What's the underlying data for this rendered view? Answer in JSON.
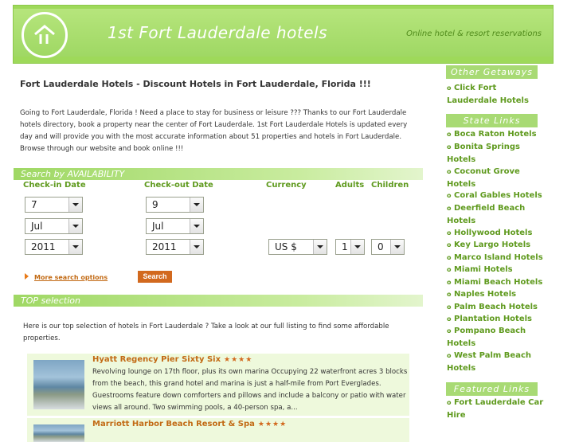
{
  "header": {
    "site_title": "1st Fort Lauderdale hotels",
    "tagline": "Online hotel & resort reservations",
    "logo_icon": "house-logo-icon"
  },
  "main": {
    "heading": "Fort Lauderdale Hotels - Discount Hotels in Fort Lauderdale, Florida !!!",
    "intro": "Going to Fort Lauderdale, Florida ! Need a place to stay for business or leisure ??? Thanks to our Fort Lauderdale hotels directory, book a property near the center of Fort Lauderdale. 1st Fort Lauderdale Hotels is updated every day and will provide you with the most accurate information about 51 properties and hotels in Fort Lauderdale. Browse through our website and book online !!!"
  },
  "search": {
    "title": "Search by AVAILABILITY",
    "labels": {
      "checkin": "Check-in Date",
      "checkout": "Check-out Date",
      "currency": "Currency",
      "adults": "Adults",
      "children": "Children"
    },
    "checkin": {
      "day": "7",
      "month": "Jul",
      "year": "2011"
    },
    "checkout": {
      "day": "9",
      "month": "Jul",
      "year": "2011"
    },
    "currency": "US $",
    "adults": "1",
    "children": "0",
    "more_options": "More search options",
    "button": "Search"
  },
  "top": {
    "title": "TOP selection",
    "intro": "Here is our top selection of hotels in Fort Lauderdale ? Take a look at our full listing to find some affordable properties.",
    "hotels": [
      {
        "name": "Hyatt Regency Pier Sixty Six",
        "stars": "★★★★",
        "description": "Revolving lounge on 17th floor, plus its own marina Occupying 22 waterfront acres 3 blocks from the beach, this grand hotel and marina is just a half-mile from Port Everglades. Guestrooms feature down comforters and pillows and include a balcony or patio with water views all around. Two swimming pools, a 40-person spa, a..."
      },
      {
        "name": "Marriott Harbor Beach Resort & Spa",
        "stars": "★★★★",
        "description": ""
      }
    ]
  },
  "sidebar": {
    "other_getaways": {
      "title": "Other Getaways",
      "items": [
        "Click Fort Lauderdale Hotels"
      ]
    },
    "state_links": {
      "title": "State Links",
      "items": [
        "Boca Raton Hotels",
        "Bonita Springs Hotels",
        "Coconut Grove Hotels",
        "Coral Gables Hotels",
        "Deerfield Beach Hotels",
        "Hollywood Hotels",
        "Key Largo Hotels",
        "Marco Island Hotels",
        "Miami Hotels",
        "Miami Beach Hotels",
        "Naples Hotels",
        "Palm Beach Hotels",
        "Plantation Hotels",
        "Pompano Beach Hotels",
        "West Palm Beach Hotels"
      ]
    },
    "featured_links": {
      "title": "Featured Links",
      "items": [
        "Fort Lauderdale Car Hire"
      ]
    },
    "bullet": "o"
  }
}
